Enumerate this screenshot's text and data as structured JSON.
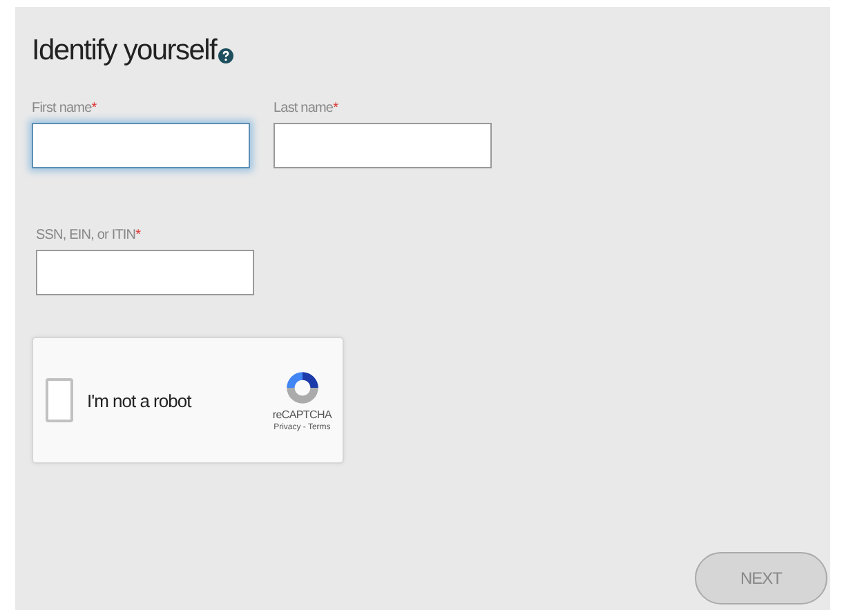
{
  "title": "Identify yourself",
  "fields": [
    {
      "label": "First name",
      "required_mark": "*",
      "focused": true
    },
    {
      "label": "Last name",
      "required_mark": "*",
      "focused": false
    },
    {
      "label": "SSN, EIN, or ITIN",
      "required_mark": "*",
      "focused": false
    }
  ],
  "captcha": {
    "label": "I'm not a robot",
    "checked": false,
    "brand": "reCAPTCHA",
    "privacy": "Privacy",
    "separator": " - ",
    "terms": "Terms"
  },
  "next_button": {
    "label": "NEXT",
    "disabled": true
  }
}
